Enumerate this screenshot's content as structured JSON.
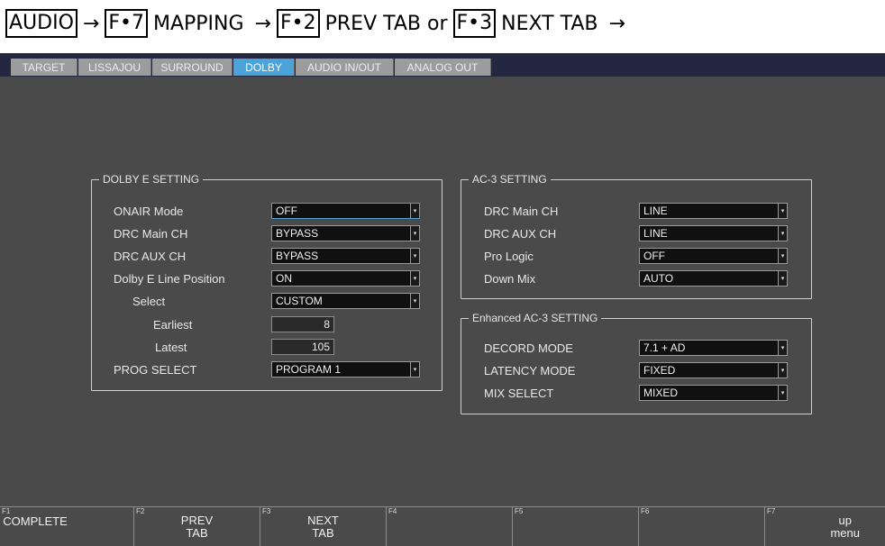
{
  "breadcrumb": {
    "step1": "AUDIO",
    "step2_key": "F•7",
    "step2_text": "MAPPING",
    "step3_key": "F•2",
    "step3_text": "PREV TAB or",
    "step4_key": "F•3",
    "step4_text": "NEXT TAB",
    "arrow": "→"
  },
  "tabs": [
    {
      "label": "TARGET",
      "active": false
    },
    {
      "label": "LISSAJOU",
      "active": false
    },
    {
      "label": "SURROUND",
      "active": false
    },
    {
      "label": "DOLBY",
      "active": true
    },
    {
      "label": "AUDIO IN/OUT",
      "active": false
    },
    {
      "label": "ANALOG OUT",
      "active": false
    }
  ],
  "dolby_e": {
    "title": "DOLBY E SETTING",
    "onair_mode": {
      "label": "ONAIR Mode",
      "value": "OFF"
    },
    "drc_main": {
      "label": "DRC Main CH",
      "value": "BYPASS"
    },
    "drc_aux": {
      "label": "DRC AUX CH",
      "value": "BYPASS"
    },
    "line_position": {
      "label": "Dolby E Line Position",
      "value": "ON"
    },
    "select": {
      "label": "Select",
      "value": "CUSTOM"
    },
    "earliest": {
      "label": "Earliest",
      "value": "8"
    },
    "latest": {
      "label": "Latest",
      "value": "105"
    },
    "prog_select": {
      "label": "PROG SELECT",
      "value": "PROGRAM 1"
    }
  },
  "ac3": {
    "title": "AC-3 SETTING",
    "drc_main": {
      "label": "DRC Main CH",
      "value": "LINE"
    },
    "drc_aux": {
      "label": "DRC AUX CH",
      "value": "LINE"
    },
    "pro_logic": {
      "label": "Pro Logic",
      "value": "OFF"
    },
    "down_mix": {
      "label": "Down Mix",
      "value": "AUTO"
    }
  },
  "eac3": {
    "title": "Enhanced AC-3 SETTING",
    "decord_mode": {
      "label": "DECORD MODE",
      "value": "7.1 + AD"
    },
    "latency_mode": {
      "label": "LATENCY MODE",
      "value": "FIXED"
    },
    "mix_select": {
      "label": "MIX SELECT",
      "value": "MIXED"
    }
  },
  "dropdown_arrow": "▾",
  "fkeys": [
    {
      "num": "F1",
      "label": "COMPLETE"
    },
    {
      "num": "F2",
      "label": "PREV\nTAB"
    },
    {
      "num": "F3",
      "label": "NEXT\nTAB"
    },
    {
      "num": "F4",
      "label": ""
    },
    {
      "num": "F5",
      "label": ""
    },
    {
      "num": "F6",
      "label": ""
    },
    {
      "num": "F7",
      "label": "up\nmenu"
    }
  ],
  "colors": {
    "accent": "#4ba3d9",
    "screen_bg": "#4a4a4a",
    "tabbar_bg": "#232740",
    "tab_bg": "#9c9c9c"
  }
}
